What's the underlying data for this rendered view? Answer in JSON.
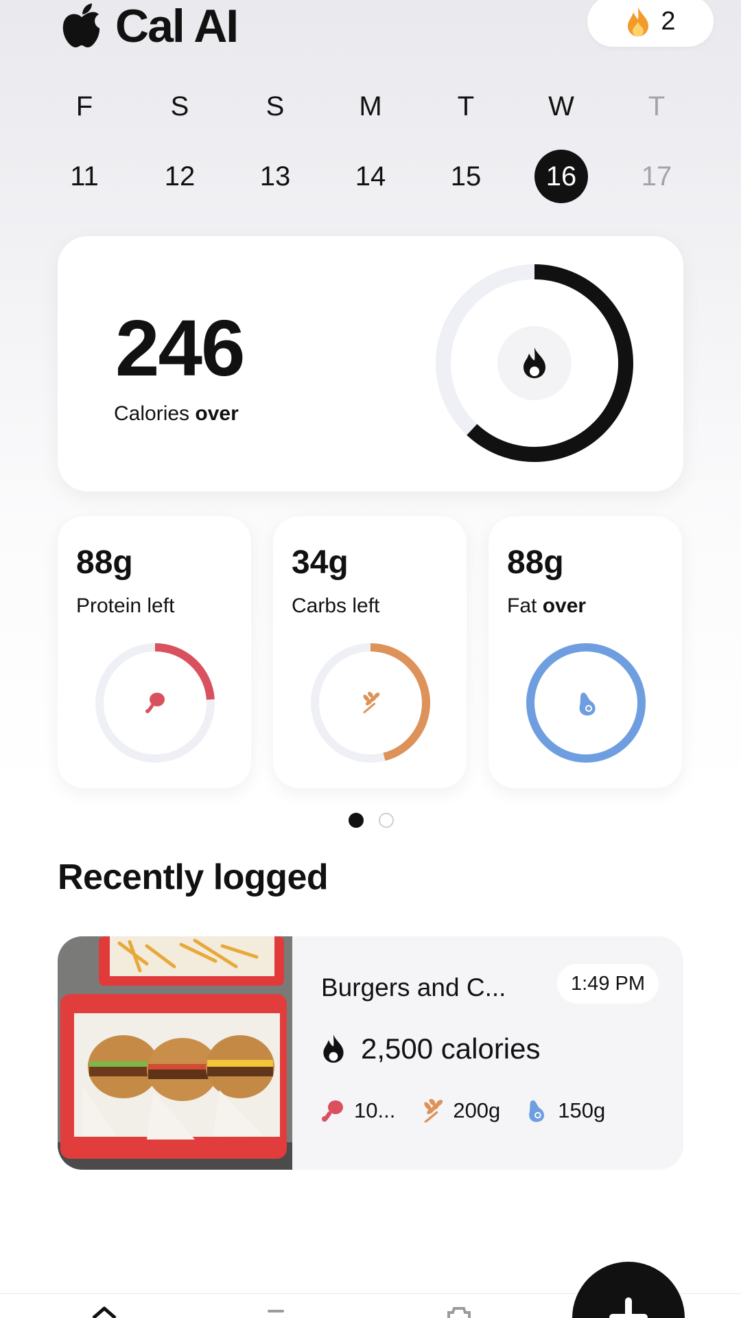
{
  "header": {
    "app_name": "Cal AI",
    "streak_count": "2",
    "streak_icon": "flame-icon"
  },
  "week": [
    {
      "letter": "F",
      "date": "11",
      "state": "past"
    },
    {
      "letter": "S",
      "date": "12",
      "state": "past"
    },
    {
      "letter": "S",
      "date": "13",
      "state": "past"
    },
    {
      "letter": "M",
      "date": "14",
      "state": "past"
    },
    {
      "letter": "T",
      "date": "15",
      "state": "past"
    },
    {
      "letter": "W",
      "date": "16",
      "state": "selected"
    },
    {
      "letter": "T",
      "date": "17",
      "state": "future"
    }
  ],
  "calories": {
    "value": "246",
    "label_prefix": "Calories ",
    "label_status": "over",
    "ring_progress": 0.62,
    "icon": "flame-icon"
  },
  "macros": [
    {
      "amount": "88g",
      "label_prefix": "Protein ",
      "label_status": "left",
      "status_bold": false,
      "color": "#d9515e",
      "progress": 0.24,
      "icon": "drumstick-icon"
    },
    {
      "amount": "34g",
      "label_prefix": "Carbs ",
      "label_status": "left",
      "status_bold": false,
      "color": "#dd925a",
      "progress": 0.46,
      "icon": "wheat-icon"
    },
    {
      "amount": "88g",
      "label_prefix": "Fat ",
      "label_status": "over",
      "status_bold": true,
      "color": "#6e9ee0",
      "progress": 1.0,
      "icon": "avocado-icon"
    }
  ],
  "pager": {
    "pages": 2,
    "active": 0
  },
  "recently_logged": {
    "title": "Recently logged",
    "items": [
      {
        "name": "Burgers and C...",
        "time": "1:49 PM",
        "calories": "2,500 calories",
        "protein": "10...",
        "carbs": "200g",
        "fat": "150g"
      }
    ]
  },
  "nav": {
    "fab_icon": "plus-icon",
    "tabs": [
      "home-icon",
      "progress-icon",
      "settings-icon"
    ]
  },
  "colors": {
    "protein": "#d9515e",
    "carbs": "#dd925a",
    "fat": "#6e9ee0",
    "ring_track": "#eff0f5",
    "dark": "#111111"
  }
}
